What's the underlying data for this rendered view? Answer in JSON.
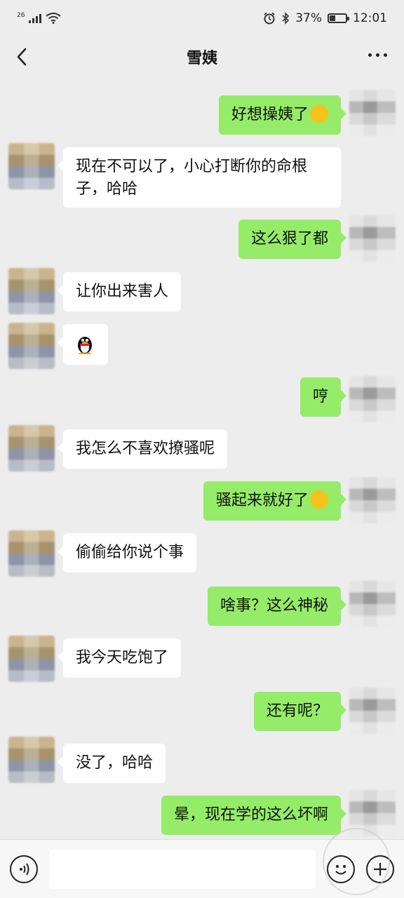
{
  "status_bar": {
    "network": "26",
    "battery": "37%",
    "battery_level": 0.37,
    "time": "12:01"
  },
  "header": {
    "title": "雪姨"
  },
  "messages": [
    {
      "side": "right",
      "text": "好想操姨了",
      "emoji": "crying-face-emoji"
    },
    {
      "side": "left",
      "text": "现在不可以了，小心打断你的命根子，哈哈"
    },
    {
      "side": "right",
      "text": "这么狠了都"
    },
    {
      "side": "left",
      "text": "让你出来害人"
    },
    {
      "side": "left",
      "text": "",
      "emoji": "qq-penguin-emoji"
    },
    {
      "side": "right",
      "text": "哼"
    },
    {
      "side": "left",
      "text": "我怎么不喜欢撩骚呢"
    },
    {
      "side": "right",
      "text": "骚起来就好了",
      "emoji": "thinking-face-emoji"
    },
    {
      "side": "left",
      "text": "偷偷给你说个事"
    },
    {
      "side": "right",
      "text": "啥事？这么神秘"
    },
    {
      "side": "left",
      "text": "我今天吃饱了"
    },
    {
      "side": "right",
      "text": "还有呢？"
    },
    {
      "side": "left",
      "text": "没了，哈哈"
    },
    {
      "side": "right",
      "text": "晕，现在学的这么坏啊"
    }
  ],
  "input": {
    "value": "",
    "placeholder": ""
  },
  "colors": {
    "background": "#ededed",
    "sent_bubble": "#95ec69",
    "received_bubble": "#ffffff"
  }
}
